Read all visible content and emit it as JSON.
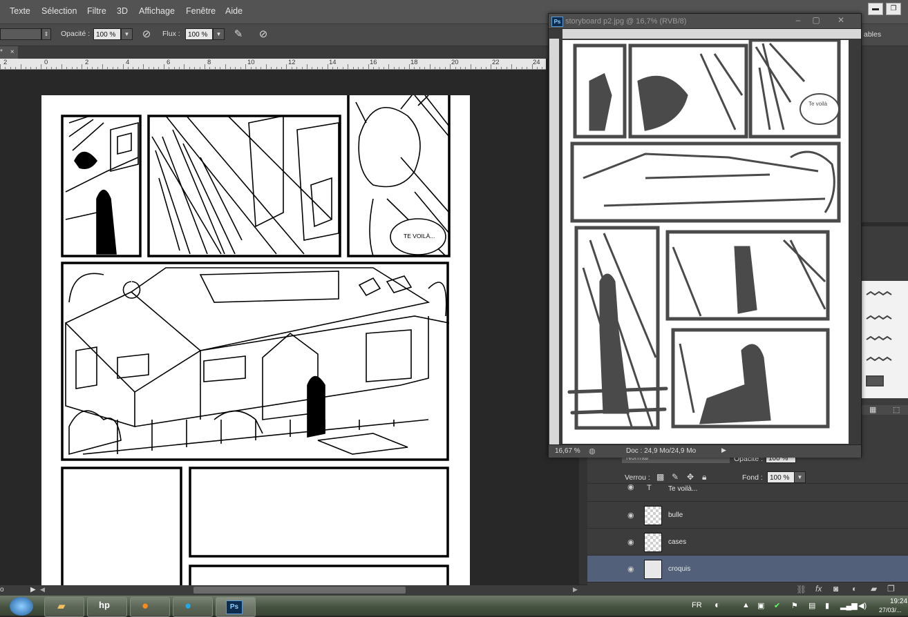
{
  "menu": [
    "Texte",
    "Sélection",
    "Filtre",
    "3D",
    "Affichage",
    "Fenêtre",
    "Aide"
  ],
  "options": {
    "opacity_label": "Opacité :",
    "opacity_value": "100 %",
    "flow_label": "Flux :",
    "flow_value": "100 %",
    "right_partial": "ables"
  },
  "tab": {
    "label": "*",
    "close": "×"
  },
  "ruler_ticks": [
    "2",
    "0",
    "2",
    "4",
    "6",
    "8",
    "10",
    "12",
    "14",
    "16",
    "18",
    "20",
    "22",
    "24"
  ],
  "page": {
    "speech_bubble": "TE VOILÀ..."
  },
  "doc_window": {
    "title": "storyboard p2.jpg @ 16,7% (RVB/8)",
    "zoom": "16,67 %",
    "doc_info": "Doc : 24,9 Mo/24,9 Mo",
    "sketch_text": "Te voilà"
  },
  "layers": {
    "blend_mode": "Normal",
    "opacity_label": "Opacité :",
    "opacity_value": "100 %",
    "lock_label": "Verrou :",
    "fill_label": "Fond :",
    "fill_value": "100 %",
    "items": [
      {
        "name": "Te voilà..."
      },
      {
        "name": "bulle"
      },
      {
        "name": "cases"
      },
      {
        "name": "croquis"
      }
    ]
  },
  "status": {
    "zoom": "o"
  },
  "taskbar": {
    "lang": "FR",
    "time": "19:24",
    "date": "27/03/..."
  },
  "colors": {
    "menubar": "#535353",
    "panel": "#3c3c3c",
    "selected_layer": "#526079",
    "canvas_bg": "#282828"
  }
}
